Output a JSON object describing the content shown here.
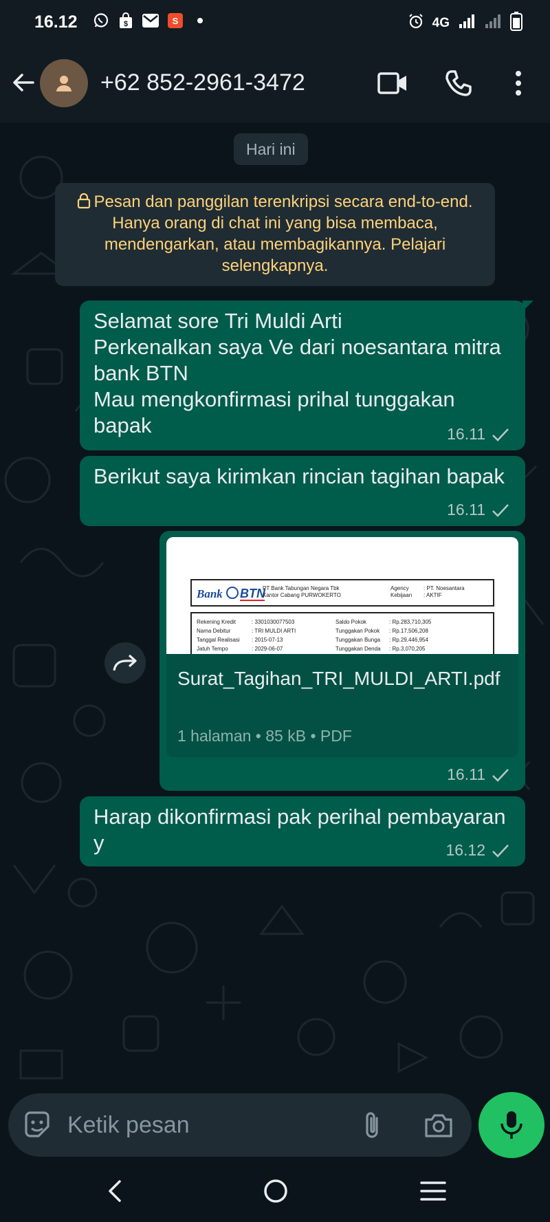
{
  "status_bar": {
    "time": "16.12",
    "network": "4G"
  },
  "header": {
    "contact": "+62 852-2961-3472"
  },
  "chat": {
    "date_chip": "Hari ini",
    "encryption_notice": "Pesan dan panggilan terenkripsi secara end-to-end. Hanya orang di chat ini yang bisa membaca, mendengarkan, atau membagikannya. Pelajari selengkapnya.",
    "messages": [
      {
        "text": "Selamat sore Tri Muldi Arti\nPerkenalkan saya Ve dari noesantara mitra bank BTN\nMau mengkonfirmasi prihal tunggakan bapak",
        "time": "16.11"
      },
      {
        "text": "Berikut saya kirimkan rincian tagihan bapak",
        "time": "16.11"
      },
      {
        "document": {
          "filename": "Surat_Tagihan_TRI_MULDI_ARTI.pdf",
          "meta": "1 halaman • 85 kB • PDF",
          "preview": {
            "brand": "Bank",
            "brand2": "BTN",
            "bank_name": "PT Bank Tabungan Negara Tbk",
            "branch": "Kantor Cabang PURWOKERTO",
            "agency_label": "Agency",
            "agency_value": ": PT. Noesantara",
            "kebijakan_label": "Kebijaan",
            "kebijakan_value": ": AKTIF",
            "rows": [
              {
                "l1": "Rekening Kredit",
                "v1": ": 3301030077503",
                "l2": "Saldo Pokok",
                "v2": ": Rp.283,710,305"
              },
              {
                "l1": "Nama Debitur",
                "v1": ": TRI MULDI ARTI",
                "l2": "Tunggakan Pokok",
                "v2": ": Rp.17,506,208"
              },
              {
                "l1": "Tanggal Realisasi",
                "v1": ": 2015-07-13",
                "l2": "Tunggakan Bunga",
                "v2": ": Rp.29,446,954"
              },
              {
                "l1": "Jatuh Tempo",
                "v1": ": 2029-06-07",
                "l2": "Tunggakan Denda",
                "v2": ": Rp.3,070,205"
              }
            ]
          }
        },
        "time": "16.11"
      },
      {
        "text": "Harap dikonfirmasi pak perihal pembayaran y",
        "time": "16.12"
      }
    ]
  },
  "composer": {
    "placeholder": "Ketik pesan"
  },
  "icons": {
    "back": "arrow-left-icon",
    "video": "video-call-icon",
    "call": "phone-icon",
    "menu": "more-vert-icon",
    "emoji": "sticker-icon",
    "attach": "paperclip-icon",
    "camera": "camera-icon",
    "mic": "mic-icon",
    "forward": "forward-icon"
  },
  "colors": {
    "background": "#0b141a",
    "bar": "#111b21",
    "outgoing_bubble": "#005c4b",
    "system_text": "#ffd279",
    "accent": "#21c063"
  }
}
